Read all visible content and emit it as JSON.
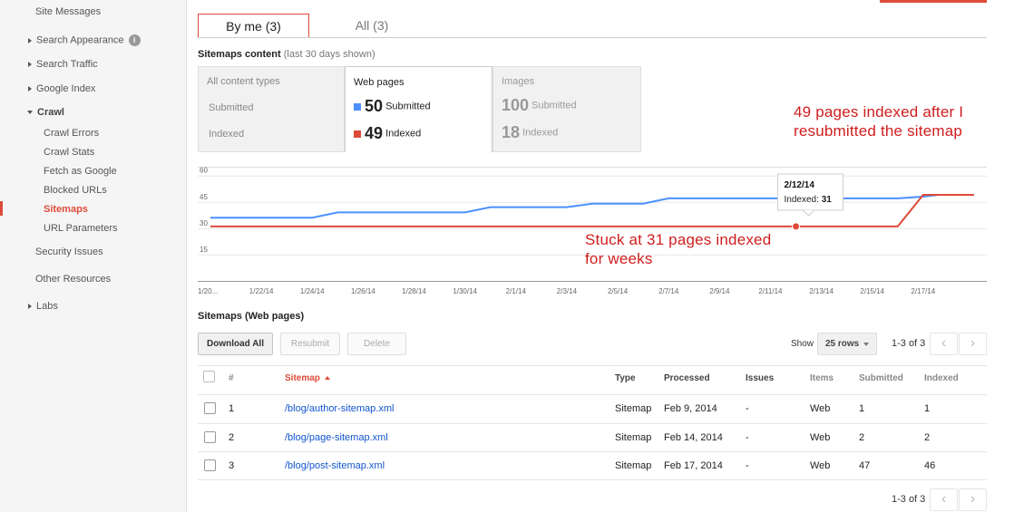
{
  "sidebar": {
    "items": [
      {
        "label": "Site Messages"
      },
      {
        "label": "Search Appearance"
      },
      {
        "label": "Search Traffic"
      },
      {
        "label": "Google Index"
      },
      {
        "label": "Crawl"
      },
      {
        "label": "Crawl Errors"
      },
      {
        "label": "Crawl Stats"
      },
      {
        "label": "Fetch as Google"
      },
      {
        "label": "Blocked URLs"
      },
      {
        "label": "Sitemaps"
      },
      {
        "label": "URL Parameters"
      },
      {
        "label": "Security Issues"
      },
      {
        "label": "Other Resources"
      },
      {
        "label": "Labs"
      }
    ],
    "info_glyph": "i",
    "active_color": "#dd4b39"
  },
  "tabs": {
    "by_me": "By me (3)",
    "all": "All (3)"
  },
  "content_section": {
    "title": "Sitemaps content",
    "subtitle": "(last 30 days shown)"
  },
  "content_types": {
    "all": {
      "label": "All content types",
      "submitted": "Submitted",
      "indexed": "Indexed"
    },
    "web": {
      "label": "Web pages",
      "submitted_num": "50",
      "submitted": "Submitted",
      "indexed_num": "49",
      "indexed": "Indexed"
    },
    "images": {
      "label": "Images",
      "submitted_num": "100",
      "submitted": "Submitted",
      "indexed_num": "18",
      "indexed": "Indexed"
    }
  },
  "chart_data": {
    "type": "line",
    "y_ticks": [
      "60",
      "45",
      "30",
      "15"
    ],
    "ylim": [
      0,
      65
    ],
    "x_ticks": [
      "1/20...",
      "1/22/14",
      "1/24/14",
      "1/26/14",
      "1/28/14",
      "1/30/14",
      "2/1/14",
      "2/3/14",
      "2/5/14",
      "2/7/14",
      "2/9/14",
      "2/11/14",
      "2/13/14",
      "2/15/14",
      "2/17/14"
    ],
    "series": [
      {
        "name": "Submitted",
        "color": "#4d90fe",
        "points": [
          [
            0,
            36
          ],
          [
            4,
            36
          ],
          [
            5,
            39
          ],
          [
            10,
            39
          ],
          [
            11,
            42
          ],
          [
            15,
            42
          ],
          [
            16,
            45
          ],
          [
            18,
            45
          ],
          [
            19,
            47
          ],
          [
            34,
            47
          ],
          [
            35,
            48
          ],
          [
            27.5,
            48
          ],
          [
            28,
            48
          ],
          [
            28.5,
            49
          ],
          [
            29.5,
            50
          ],
          [
            30,
            50
          ]
        ]
      },
      {
        "name": "Indexed",
        "color": "#dd4b39",
        "points": [
          [
            0,
            31
          ],
          [
            27,
            31
          ],
          [
            28,
            49
          ],
          [
            29,
            49
          ]
        ]
      }
    ],
    "tooltip": {
      "date": "2/12/14",
      "label": "Indexed:",
      "value": "31"
    }
  },
  "annotations": {
    "top_line1": "49 pages indexed after I",
    "top_line2": "resubmitted the sitemap",
    "mid_line1": "Stuck at 31 pages indexed",
    "mid_line2": "for weeks"
  },
  "web_section": {
    "title": "Sitemaps (Web pages)"
  },
  "toolbar": {
    "download_all": "Download All",
    "resubmit": "Resubmit",
    "delete": "Delete",
    "show_label": "Show",
    "rows_value": "25 rows",
    "pager_text": "1-3 of 3",
    "prev_glyph": "‹",
    "next_glyph": "›"
  },
  "table": {
    "headers": {
      "num": "#",
      "sitemap": "Sitemap",
      "type": "Type",
      "processed": "Processed",
      "issues": "Issues",
      "items": "Items",
      "submitted": "Submitted",
      "indexed": "Indexed"
    },
    "rows": [
      {
        "num": "1",
        "sitemap": "/blog/author-sitemap.xml",
        "type": "Sitemap",
        "processed": "Feb 9, 2014",
        "issues": "-",
        "items": "Web",
        "submitted": "1",
        "indexed": "1"
      },
      {
        "num": "2",
        "sitemap": "/blog/page-sitemap.xml",
        "type": "Sitemap",
        "processed": "Feb 14, 2014",
        "issues": "-",
        "items": "Web",
        "submitted": "2",
        "indexed": "2"
      },
      {
        "num": "3",
        "sitemap": "/blog/post-sitemap.xml",
        "type": "Sitemap",
        "processed": "Feb 17, 2014",
        "issues": "-",
        "items": "Web",
        "submitted": "47",
        "indexed": "46"
      }
    ]
  },
  "footer_pager": {
    "text": "1-3 of 3"
  }
}
